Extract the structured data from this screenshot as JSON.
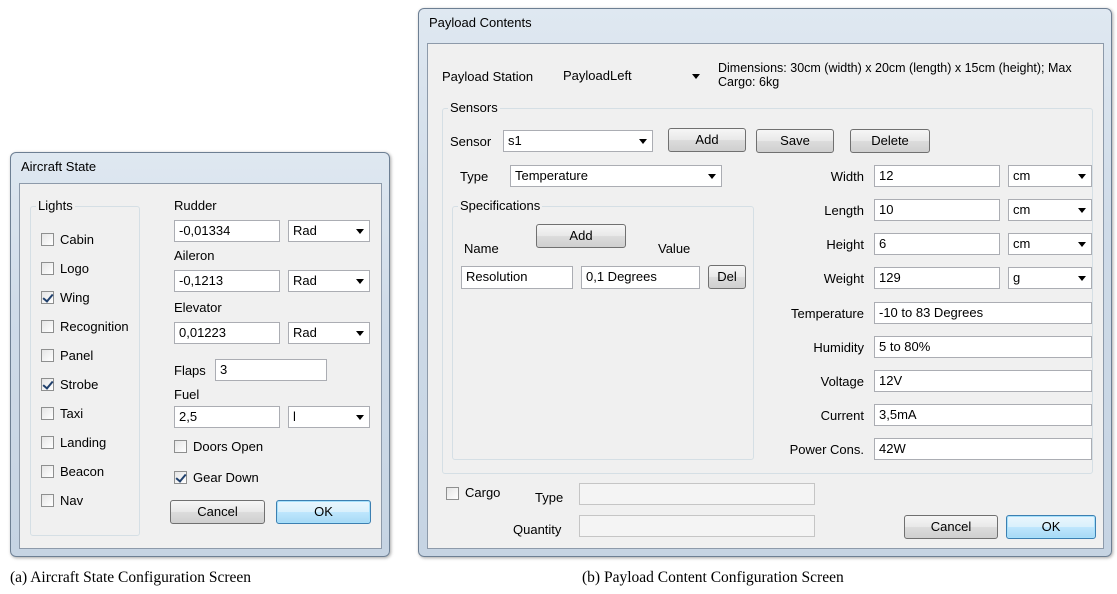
{
  "aircraft_state": {
    "title": "Aircraft State",
    "lights_group_label": "Lights",
    "lights": [
      {
        "label": "Cabin",
        "checked": false
      },
      {
        "label": "Logo",
        "checked": false
      },
      {
        "label": "Wing",
        "checked": true
      },
      {
        "label": "Recognition",
        "checked": false
      },
      {
        "label": "Panel",
        "checked": false
      },
      {
        "label": "Strobe",
        "checked": true
      },
      {
        "label": "Taxi",
        "checked": false
      },
      {
        "label": "Landing",
        "checked": false
      },
      {
        "label": "Beacon",
        "checked": false
      },
      {
        "label": "Nav",
        "checked": false
      }
    ],
    "rudder": {
      "label": "Rudder",
      "value": "-0,01334",
      "unit": "Rad"
    },
    "aileron": {
      "label": "Aileron",
      "value": "-0,1213",
      "unit": "Rad"
    },
    "elevator": {
      "label": "Elevator",
      "value": "0,01223",
      "unit": "Rad"
    },
    "flaps": {
      "label": "Flaps",
      "value": "3"
    },
    "fuel": {
      "label": "Fuel",
      "value": "2,5",
      "unit": "l"
    },
    "doors_open": {
      "label": "Doors Open",
      "checked": false
    },
    "gear_down": {
      "label": "Gear Down",
      "checked": true
    },
    "cancel_label": "Cancel",
    "ok_label": "OK"
  },
  "payload_contents": {
    "title": "Payload Contents",
    "station_label": "Payload Station",
    "station_value": "PayloadLeft",
    "dimensions_line1": "Dimensions: 30cm (width) x 20cm (length) x 15cm (height); Max",
    "dimensions_line2": "Cargo: 6kg",
    "sensors_group_label": "Sensors",
    "sensor_label": "Sensor",
    "sensor_value": "s1",
    "add_label": "Add",
    "save_label": "Save",
    "delete_label": "Delete",
    "type_label": "Type",
    "type_value": "Temperature",
    "specifications_group_label": "Specifications",
    "spec_add_label": "Add",
    "spec_name_header": "Name",
    "spec_value_header": "Value",
    "spec_name": "Resolution",
    "spec_value": "0,1 Degrees",
    "spec_del_label": "Del",
    "properties": [
      {
        "label": "Width",
        "value": "12",
        "unit": "cm"
      },
      {
        "label": "Length",
        "value": "10",
        "unit": "cm"
      },
      {
        "label": "Height",
        "value": "6",
        "unit": "cm"
      },
      {
        "label": "Weight",
        "value": "129",
        "unit": "g"
      },
      {
        "label": "Temperature",
        "value": "-10 to 83 Degrees"
      },
      {
        "label": "Humidity",
        "value": "5 to 80%"
      },
      {
        "label": "Voltage",
        "value": "12V"
      },
      {
        "label": "Current",
        "value": "3,5mA"
      },
      {
        "label": "Power Cons.",
        "value": "42W"
      }
    ],
    "cargo_label": "Cargo",
    "cargo_checked": false,
    "cargo_type_label": "Type",
    "cargo_type_value": "",
    "cargo_quantity_label": "Quantity",
    "cargo_quantity_value": "",
    "cancel_label": "Cancel",
    "ok_label": "OK"
  },
  "captions": {
    "a": "(a)  Aircraft State Configuration Screen",
    "b": "(b)  Payload Content Configuration Screen"
  }
}
